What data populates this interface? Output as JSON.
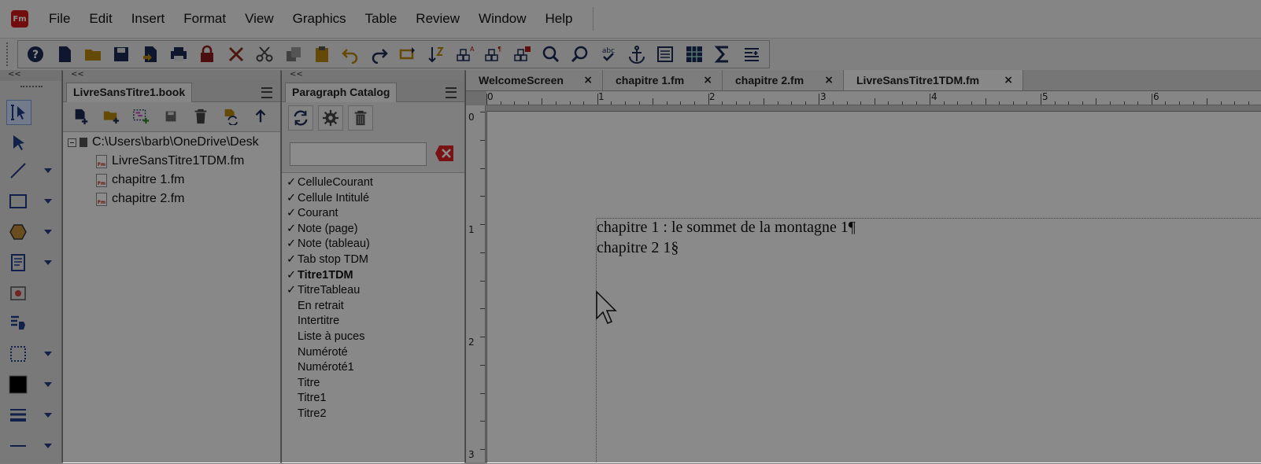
{
  "app": {
    "logo_text": "Fm"
  },
  "menubar": {
    "items": [
      "File",
      "Edit",
      "Insert",
      "Format",
      "View",
      "Graphics",
      "Table",
      "Review",
      "Window",
      "Help"
    ]
  },
  "toolbar": {
    "icons": [
      "help-icon",
      "new-document-icon",
      "open-folder-icon",
      "save-icon",
      "save-as-icon",
      "print-icon",
      "lock-icon",
      "delete-icon",
      "cut-icon",
      "copy-icon",
      "paste-icon",
      "undo-icon",
      "redo-icon",
      "repeat-icon",
      "sort-icon",
      "character-format-icon",
      "paragraph-format-icon",
      "table-format-icon",
      "zoom-icon",
      "find-icon",
      "spelling-icon",
      "anchor-icon",
      "text-frame-icon",
      "table-icon",
      "sum-icon",
      "paragraph-list-icon"
    ]
  },
  "toolcol": {
    "collapse": "<<"
  },
  "book_panel": {
    "collapse": "<<",
    "tab": "LivreSansTitre1.book",
    "root": "C:\\Users\\barb\\OneDrive\\Desk",
    "files": [
      "LivreSansTitre1TDM.fm",
      "chapitre 1.fm",
      "chapitre 2.fm"
    ]
  },
  "para_panel": {
    "collapse": "<<",
    "tab": "Paragraph Catalog",
    "search_value": "",
    "items": [
      {
        "name": "CelluleCourant",
        "used": true,
        "bold": false
      },
      {
        "name": "Cellule Intitulé",
        "used": true,
        "bold": false
      },
      {
        "name": "Courant",
        "used": true,
        "bold": false
      },
      {
        "name": "Note (page)",
        "used": true,
        "bold": false
      },
      {
        "name": "Note (tableau)",
        "used": true,
        "bold": false
      },
      {
        "name": "Tab stop TDM",
        "used": true,
        "bold": false
      },
      {
        "name": "Titre1TDM",
        "used": true,
        "bold": true
      },
      {
        "name": "TitreTableau",
        "used": true,
        "bold": false
      },
      {
        "name": "En retrait",
        "used": false,
        "bold": false
      },
      {
        "name": "Intertitre",
        "used": false,
        "bold": false
      },
      {
        "name": "Liste à puces",
        "used": false,
        "bold": false
      },
      {
        "name": "Numéroté",
        "used": false,
        "bold": false
      },
      {
        "name": "Numéroté1",
        "used": false,
        "bold": false
      },
      {
        "name": "Titre",
        "used": false,
        "bold": false
      },
      {
        "name": "Titre1",
        "used": false,
        "bold": false
      },
      {
        "name": "Titre2",
        "used": false,
        "bold": false
      }
    ],
    "check_mark": "✓"
  },
  "doc": {
    "tabs": [
      {
        "label": "WelcomeScreen",
        "close": "×"
      },
      {
        "label": "chapitre 1.fm",
        "close": "×"
      },
      {
        "label": "chapitre 2.fm",
        "close": "×"
      },
      {
        "label": "LivreSansTitre1TDM.fm",
        "close": "×"
      }
    ],
    "hruler_labels": [
      "0",
      "1",
      "2",
      "3",
      "4",
      "5",
      "6"
    ],
    "vruler_labels": [
      "0",
      "1",
      "2",
      "3"
    ],
    "lines": [
      "chapitre 1 : le sommet de la montagne 1¶",
      "chapitre 2 1§"
    ]
  }
}
